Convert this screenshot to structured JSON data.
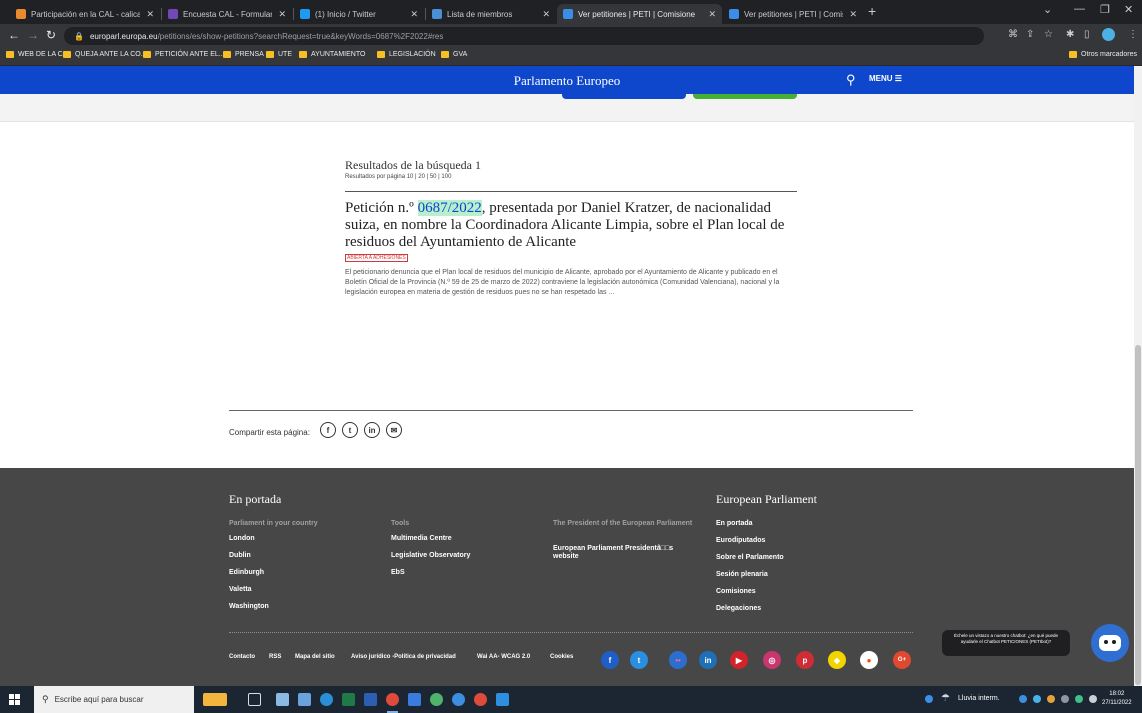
{
  "browser": {
    "tabs": [
      {
        "title": "Participación en la CAL - calicant",
        "favicon_color": "#e88a2e",
        "active": false
      },
      {
        "title": "Encuesta CAL - Formularios de G",
        "favicon_color": "#7248b9",
        "active": false
      },
      {
        "title": "(1) Inicio / Twitter",
        "favicon_color": "#1d9bf0",
        "active": false
      },
      {
        "title": "Lista de miembros",
        "favicon_color": "#4a90d9",
        "active": false
      },
      {
        "title": "Ver petitiones | PETI | Comisione",
        "favicon_color": "#3b8ee8",
        "active": true
      },
      {
        "title": "Ver petitiones | PETI | Comisione",
        "favicon_color": "#3b8ee8",
        "active": false
      }
    ],
    "new_tab_icon": "+",
    "url_host": "europarl.europa.eu",
    "url_path": "/petitions/es/show-petitions?searchRequest=true&keyWords=0687%2F2022#res",
    "bookmarks": [
      "WEB DE LA CAL",
      "QUEJA ANTE LA CO...",
      "PETICIÓN ANTE EL...",
      "PRENSA",
      "UTE",
      "AYUNTAMIENTO",
      "LEGISLACIÓN",
      "GVA"
    ],
    "other_bookmarks": "Otros marcadores"
  },
  "header": {
    "title": "Parlamento Europeo",
    "menu_label": "MENU ☰"
  },
  "results": {
    "title": "Resultados de la búsqueda 1",
    "per_page": "Resultados por página 10 | 20 | 50 | 100",
    "petition_prefix": "Petición n.º ",
    "petition_number": "0687/2022",
    "petition_rest": ", presentada por Daniel Kratzer, de nacionalidad suiza, en nombre la Coordinadora Alicante Limpia, sobre el Plan local de residuos del Ayuntamiento de Alicante",
    "status": "ABIERTA A ADHESIONES",
    "summary": "El peticionario denuncia que el Plan local de residuos del municipio de Alicante, aprobado por el Ayuntamiento de Alicante y publicado en el Boletín Oficial de la Provincia (N.º 59 de 25 de marzo de 2022) contraviene la legislación autonómica (Comunidad Valenciana), nacional y la legislación europea en materia de gestión de residuos pues no se han respetado las ..."
  },
  "share": {
    "label": "Compartir esta página:",
    "icons": [
      {
        "name": "facebook-share-icon",
        "glyph": "f"
      },
      {
        "name": "twitter-share-icon",
        "glyph": "t"
      },
      {
        "name": "linkedin-share-icon",
        "glyph": "in"
      },
      {
        "name": "email-share-icon",
        "glyph": "✉"
      }
    ]
  },
  "footer": {
    "left_heading": "En portada",
    "right_heading": "European Parliament",
    "col1_head": "Parliament in your country",
    "col1_links": [
      "London",
      "Dublin",
      "Edinburgh",
      "Valetta",
      "Washington"
    ],
    "col2_head": "Tools",
    "col2_links": [
      "Multimedia Centre",
      "Legislative Observatory",
      "EbS"
    ],
    "col3_head": "The President of the European Parliament",
    "col3_link": "European Parliament Presidentâ□□s website",
    "col4_links": [
      "En portada",
      "Eurodiputados",
      "Sobre el Parlamento",
      "Sesión plenaria",
      "Comisiones",
      "Delegaciones"
    ],
    "bottom_links": [
      "Contacto",
      "RSS",
      "Mapa del sitio",
      "Aviso jurídico -Política de privacidad",
      "Wai AA- WCAG 2.0",
      "Cookies"
    ],
    "social_icons": [
      {
        "name": "facebook-icon",
        "glyph": "f"
      },
      {
        "name": "twitter-icon",
        "glyph": "t"
      },
      {
        "name": "flickr-icon",
        "glyph": "••"
      },
      {
        "name": "linkedin-icon",
        "glyph": "in"
      },
      {
        "name": "youtube-icon",
        "glyph": "▶"
      },
      {
        "name": "instagram-icon",
        "glyph": "◎"
      },
      {
        "name": "pinterest-icon",
        "glyph": "p"
      },
      {
        "name": "snapchat-icon",
        "glyph": "◆"
      },
      {
        "name": "reddit-icon",
        "glyph": "●"
      },
      {
        "name": "googleplus-icon",
        "glyph": "G+"
      }
    ],
    "chat_bubble": "Échele un vistazo a nuestro chatbot: ¿en qué puede ayudarle el Chatbot PETICIONES (PETIbot)?"
  },
  "taskbar": {
    "search_placeholder": "Escribe aquí para buscar",
    "weather": "Lluvia interm.",
    "time": "18:02",
    "date": "27/11/2022"
  },
  "colors": {
    "ep_blue": "#0e47cb",
    "ep_green": "#46b036",
    "highlight": "#b7efcf",
    "footer_bg": "#474748"
  }
}
